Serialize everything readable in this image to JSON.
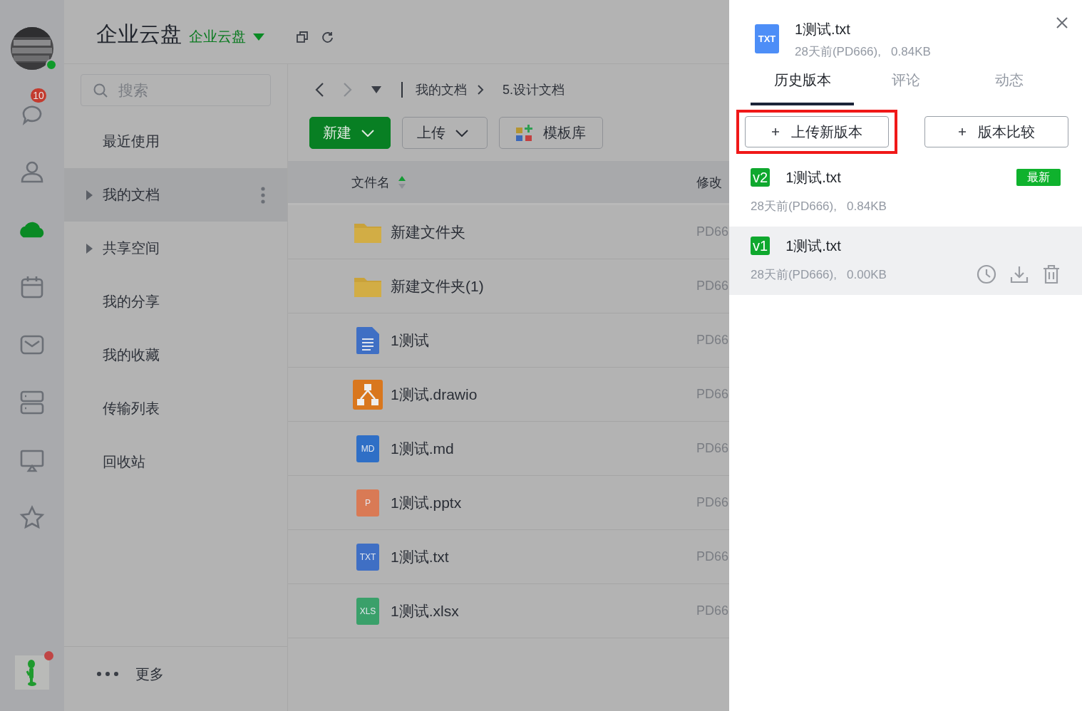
{
  "rail": {
    "avatar": {
      "kind": "picture",
      "online": true
    },
    "items": [
      {
        "kind": "chat",
        "badge": "10",
        "selected": false
      },
      {
        "kind": "person",
        "selected": false
      },
      {
        "kind": "cloud",
        "selected": true
      },
      {
        "kind": "calendar",
        "selected": false
      },
      {
        "kind": "mail",
        "selected": false
      },
      {
        "kind": "server",
        "selected": false
      },
      {
        "kind": "screen",
        "selected": false
      },
      {
        "kind": "star",
        "selected": false
      }
    ],
    "user": {
      "notification": true
    }
  },
  "header": {
    "title": "企业云盘",
    "space": "企业云盘"
  },
  "sidebar": {
    "search": {
      "placeholder": "搜索"
    },
    "items": [
      {
        "label": "最近使用",
        "expandable": false,
        "selected": false
      },
      {
        "label": "我的文档",
        "expandable": true,
        "selected": true
      },
      {
        "label": "共享空间",
        "expandable": true,
        "selected": false
      },
      {
        "label": "我的分享",
        "expandable": false,
        "selected": false
      },
      {
        "label": "我的收藏",
        "expandable": false,
        "selected": false
      },
      {
        "label": "传输列表",
        "expandable": false,
        "selected": false
      },
      {
        "label": "回收站",
        "expandable": false,
        "selected": false
      }
    ],
    "more": "更多"
  },
  "breadcrumb": [
    "我的文档",
    "5.设计文档"
  ],
  "toolbar": [
    {
      "kind": "primary",
      "label": "新建"
    },
    {
      "kind": "dropdown",
      "label": "上传"
    },
    {
      "kind": "template",
      "label": "模板库"
    }
  ],
  "table": {
    "columns": [
      {
        "label": "文件名",
        "sort_ascending": true
      },
      {
        "label": "修改"
      }
    ],
    "rows": [
      {
        "kind": "folder",
        "name": "新建文件夹",
        "modifier": "PD66"
      },
      {
        "kind": "folder",
        "name": "新建文件夹(1)",
        "modifier": "PD66"
      },
      {
        "kind": "doc",
        "name": "1测试",
        "modifier": "PD66"
      },
      {
        "kind": "drawio",
        "name": "1测试.drawio",
        "modifier": "PD66"
      },
      {
        "kind": "md",
        "badge": "MD",
        "name": "1测试.md",
        "modifier": "PD66"
      },
      {
        "kind": "pptx",
        "badge": "P",
        "name": "1测试.pptx",
        "modifier": "PD66"
      },
      {
        "kind": "txt",
        "badge": "TXT",
        "name": "1测试.txt",
        "modifier": "PD66"
      },
      {
        "kind": "xlsx",
        "badge": "XLS",
        "name": "1测试.xlsx",
        "modifier": "PD66"
      }
    ]
  },
  "panel": {
    "file": {
      "badge": "TXT",
      "name": "1测试.txt",
      "meta": "28天前(PD666),   0.84KB"
    },
    "tabs": [
      {
        "label": "历史版本",
        "selected": true
      },
      {
        "label": "评论",
        "selected": false
      },
      {
        "label": "动态",
        "selected": false
      }
    ],
    "buttons": [
      {
        "label": "上传新版本",
        "highlighted": true
      },
      {
        "label": "版本比较",
        "highlighted": false
      }
    ],
    "versions": [
      {
        "tag": "v2",
        "name": "1测试.txt",
        "latest": "最新",
        "meta": "28天前(PD666),   0.84KB",
        "selected": false
      },
      {
        "tag": "v1",
        "name": "1测试.txt",
        "meta": "28天前(PD666),   0.00KB",
        "selected": true
      }
    ]
  }
}
